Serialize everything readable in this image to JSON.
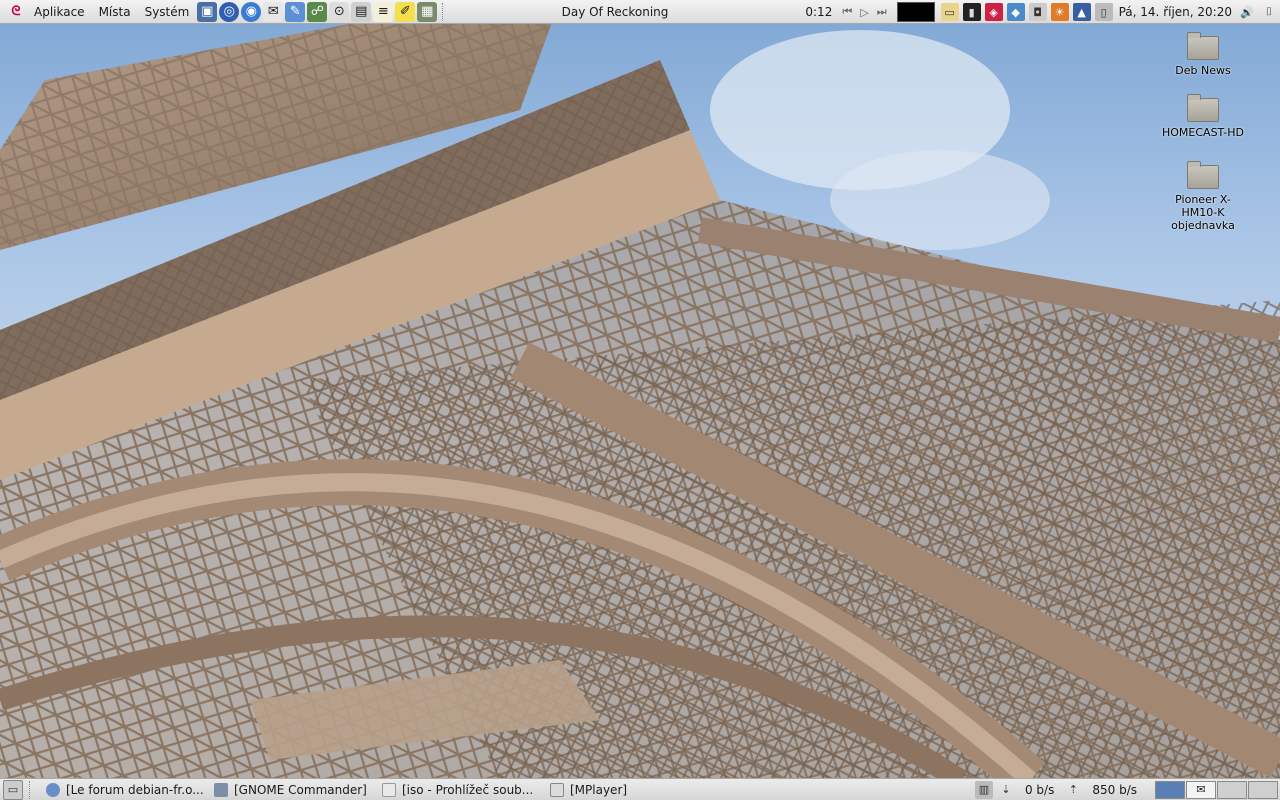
{
  "top_panel": {
    "menus": [
      "Aplikace",
      "Místa",
      "Systém"
    ],
    "window_title": "Day Of Reckoning",
    "media": {
      "time": "0:12"
    },
    "clock": "Pá, 14. říjen, 20:20",
    "launcher_icons": [
      "monitor-icon",
      "globe-icon",
      "browser-icon",
      "mail-icon",
      "editor-icon",
      "network-icon",
      "torrent-icon",
      "image-icon",
      "notepad-icon",
      "highlighter-icon",
      "calculator-icon"
    ],
    "tray_icons": [
      "drive-icon",
      "terminal-icon",
      "applications-icon",
      "network-tray-icon",
      "speaker-device-icon",
      "weather-icon",
      "signal-icon",
      "power-icon"
    ]
  },
  "desktop": {
    "icons": [
      {
        "label": "Deb News"
      },
      {
        "label": "HOMECAST-HD"
      },
      {
        "label": "Pioneer X-HM10-K objednavka"
      }
    ]
  },
  "taskbar": {
    "tasks": [
      {
        "label": "[Le forum debian-fr.o..."
      },
      {
        "label": "[GNOME Commander]"
      },
      {
        "label": "[iso - Prohlížeč soub..."
      },
      {
        "label": "[MPlayer]"
      }
    ],
    "net_down": "0 b/s",
    "net_up": "850 b/s"
  },
  "colors": {
    "panel": "#dcdcdc",
    "sky": "#a9c5e6",
    "iron": "#9b8472",
    "workspace_active": "#5b7fb5"
  }
}
